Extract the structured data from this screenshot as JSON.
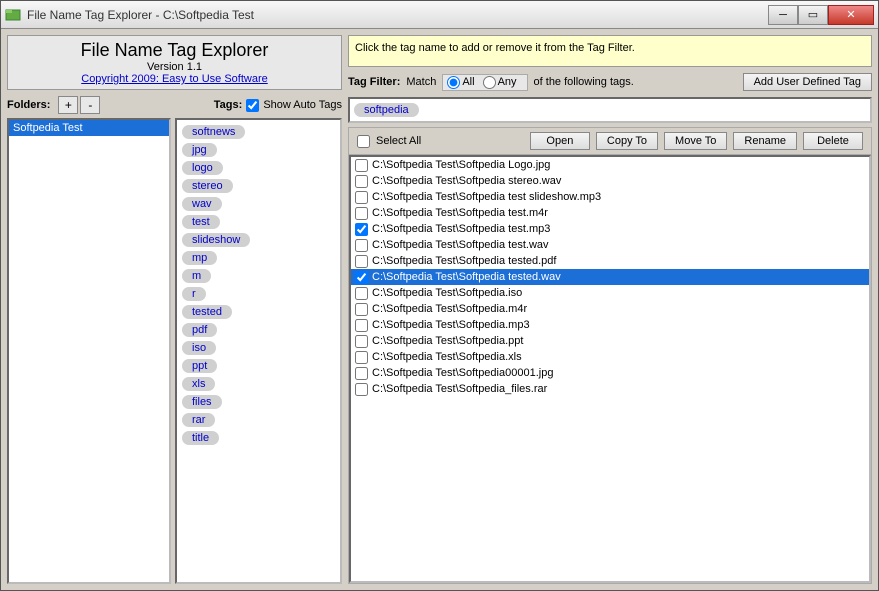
{
  "window": {
    "title": "File Name Tag Explorer - C:\\Softpedia Test"
  },
  "header": {
    "app_title": "File Name Tag Explorer",
    "version": "Version 1.1",
    "copyright": "Copyright 2009: Easy to Use Software"
  },
  "labels": {
    "folders": "Folders:",
    "tags": "Tags:",
    "show_auto_tags": "Show Auto Tags",
    "tag_filter": "Tag Filter:",
    "match": "Match",
    "all": "All",
    "any": "Any",
    "of_following": "of the following tags.",
    "select_all": "Select All",
    "add_user_tag": "Add User Defined Tag",
    "plus": "+",
    "minus": "-"
  },
  "hint": "Click the tag name to add or remove it from the Tag Filter.",
  "folders": [
    {
      "name": "Softpedia Test",
      "selected": true
    }
  ],
  "tags": [
    "softnews",
    "jpg",
    "logo",
    "stereo",
    "wav",
    "test",
    "slideshow",
    "mp",
    "m",
    "r",
    "tested",
    "pdf",
    "iso",
    "ppt",
    "xls",
    "files",
    "rar",
    "title"
  ],
  "active_tags": [
    "softpedia"
  ],
  "match_mode": "all",
  "actions": {
    "open": "Open",
    "copy_to": "Copy To",
    "move_to": "Move To",
    "rename": "Rename",
    "delete": "Delete"
  },
  "files": [
    {
      "path": "C:\\Softpedia Test\\Softpedia Logo.jpg",
      "checked": false,
      "selected": false
    },
    {
      "path": "C:\\Softpedia Test\\Softpedia stereo.wav",
      "checked": false,
      "selected": false
    },
    {
      "path": "C:\\Softpedia Test\\Softpedia test slideshow.mp3",
      "checked": false,
      "selected": false
    },
    {
      "path": "C:\\Softpedia Test\\Softpedia test.m4r",
      "checked": false,
      "selected": false
    },
    {
      "path": "C:\\Softpedia Test\\Softpedia test.mp3",
      "checked": true,
      "selected": false
    },
    {
      "path": "C:\\Softpedia Test\\Softpedia test.wav",
      "checked": false,
      "selected": false
    },
    {
      "path": "C:\\Softpedia Test\\Softpedia tested.pdf",
      "checked": false,
      "selected": false
    },
    {
      "path": "C:\\Softpedia Test\\Softpedia tested.wav",
      "checked": true,
      "selected": true
    },
    {
      "path": "C:\\Softpedia Test\\Softpedia.iso",
      "checked": false,
      "selected": false
    },
    {
      "path": "C:\\Softpedia Test\\Softpedia.m4r",
      "checked": false,
      "selected": false
    },
    {
      "path": "C:\\Softpedia Test\\Softpedia.mp3",
      "checked": false,
      "selected": false
    },
    {
      "path": "C:\\Softpedia Test\\Softpedia.ppt",
      "checked": false,
      "selected": false
    },
    {
      "path": "C:\\Softpedia Test\\Softpedia.xls",
      "checked": false,
      "selected": false
    },
    {
      "path": "C:\\Softpedia Test\\Softpedia00001.jpg",
      "checked": false,
      "selected": false
    },
    {
      "path": "C:\\Softpedia Test\\Softpedia_files.rar",
      "checked": false,
      "selected": false
    }
  ]
}
